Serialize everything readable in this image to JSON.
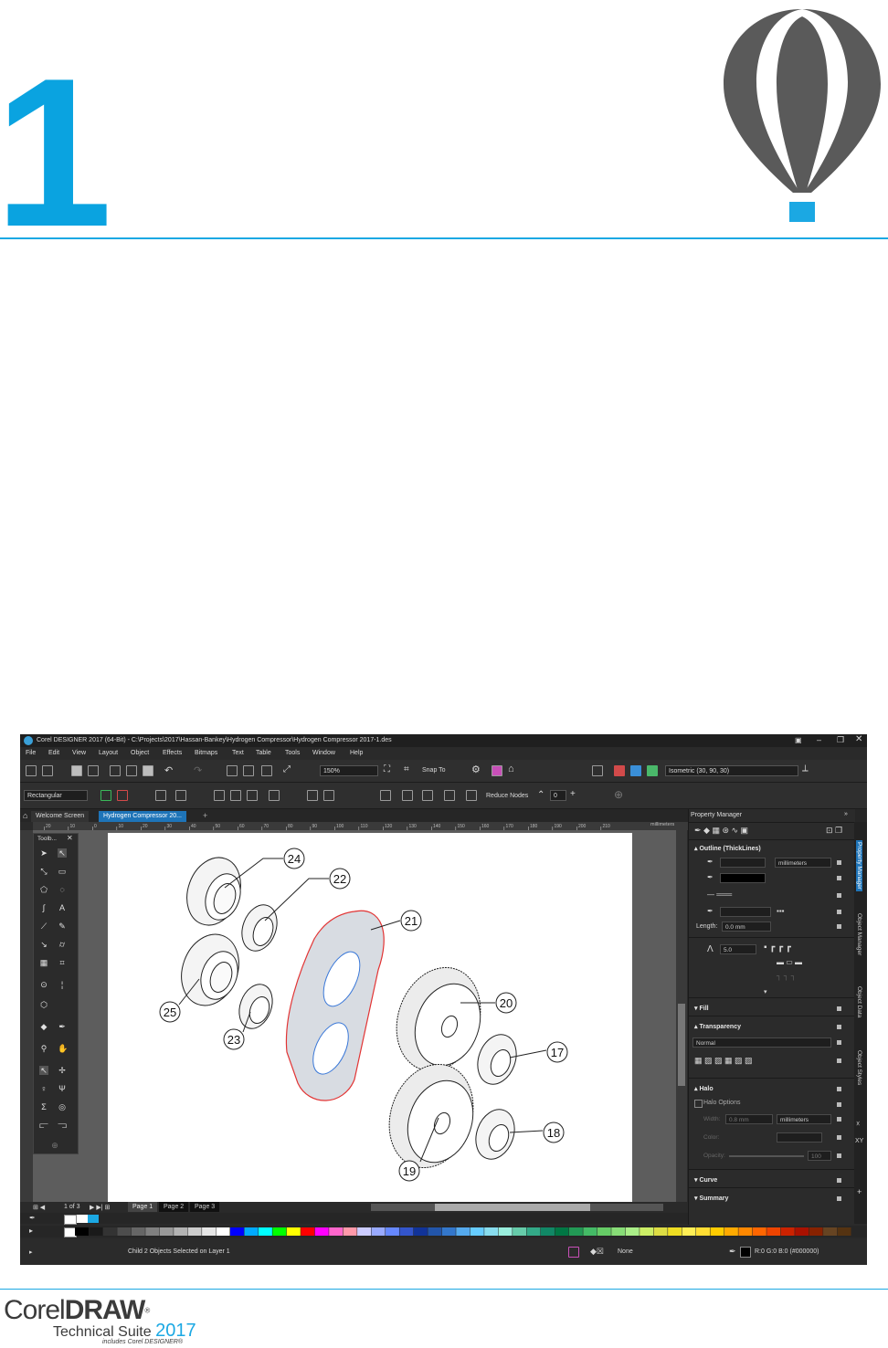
{
  "chapter": {
    "number": "1"
  },
  "brand": {
    "logo_corel": "Corel",
    "logo_draw": "DRAW",
    "logo_reg": "®",
    "logo_suite": "Technical Suite",
    "logo_year": "2017",
    "logo_tagline": "includes Corel DESIGNER®",
    "accent_color": "#1ba8e3",
    "balloon_color": "#5a5a5a"
  },
  "app": {
    "title": "Corel DESIGNER 2017 (64-Bit) - C:\\Projects\\2017\\Hassan-Bankey\\Hydrogen Compressor\\Hydrogen Compressor 2017-1.des",
    "menu": [
      "File",
      "Edit",
      "View",
      "Layout",
      "Object",
      "Effects",
      "Bitmaps",
      "Text",
      "Table",
      "Tools",
      "Window",
      "Help"
    ],
    "toolbar": {
      "zoom": "150%",
      "snap": "Snap To",
      "projection": "Isometric (30, 90, 30)"
    },
    "property_bar": {
      "shape_select": "Rectangular",
      "reduce_nodes_label": "Reduce Nodes",
      "reduce_nodes_value": "0"
    },
    "tabs": [
      "Welcome Screen",
      "Hydrogen Compressor 20..."
    ],
    "ruler_unit": "millimeters",
    "ruler_ticks": [
      "20",
      "10",
      "0",
      "10",
      "20",
      "30",
      "40",
      "50",
      "60",
      "70",
      "80",
      "90",
      "100",
      "110",
      "120",
      "130",
      "140",
      "150",
      "160",
      "170",
      "180",
      "190",
      "200",
      "210"
    ],
    "toolbox_title": "Toolb...",
    "callouts": [
      "24",
      "22",
      "21",
      "25",
      "23",
      "20",
      "17",
      "19",
      "18"
    ],
    "pages": {
      "counter": "1 of 3",
      "tabs": [
        "Page 1",
        "Page 2",
        "Page 3"
      ]
    },
    "property_manager": {
      "title": "Property Manager",
      "outline_section": "Outline (ThickLines)",
      "units": "millimeters",
      "length_label": "Length:",
      "length_value": "0.0 mm",
      "miter_value": "5.0",
      "fill_section": "Fill",
      "transparency_section": "Transparency",
      "transparency_mode": "Normal",
      "halo_section": "Halo",
      "halo_options": "Halo Options",
      "halo_width_label": "Width:",
      "halo_width": "0.8 mm",
      "halo_units": "millimeters",
      "halo_color_label": "Color:",
      "halo_opacity_label": "Opacity:",
      "halo_opacity_value": "100",
      "curve_section": "Curve",
      "summary_section": "Summary"
    },
    "side_tabs": [
      "Property Manager",
      "Object Manager",
      "Object Data",
      "Object Styles"
    ],
    "status": {
      "selection": "Child 2 Objects Selected on Layer 1",
      "fill": "None",
      "outline_color": "R:0 G:0 B:0 (#000000)"
    },
    "palette_colors": [
      "#000000",
      "#1a1a1a",
      "#333333",
      "#4d4d4d",
      "#666666",
      "#808080",
      "#999999",
      "#b3b3b3",
      "#cccccc",
      "#e6e6e6",
      "#ffffff",
      "#0000ff",
      "#00aaff",
      "#00ffff",
      "#00ff00",
      "#ffff00",
      "#ff0000",
      "#ff00ff",
      "#ff66cc",
      "#ff99aa",
      "#ccccff",
      "#99aaff",
      "#6688ff",
      "#3355cc",
      "#113399",
      "#2255aa",
      "#3377cc",
      "#55aaee",
      "#66ccff",
      "#88ddee",
      "#99eedd",
      "#66ccaa",
      "#33aa88",
      "#118866",
      "#007744",
      "#229955",
      "#44bb66",
      "#66cc66",
      "#88dd77",
      "#aaee88",
      "#ccee66",
      "#dddd44",
      "#eedd22",
      "#ffee55",
      "#ffdd33",
      "#ffcc00",
      "#ffaa00",
      "#ff8800",
      "#ff6600",
      "#ee4400",
      "#cc2200",
      "#aa1100",
      "#882200",
      "#664422",
      "#553311"
    ]
  }
}
